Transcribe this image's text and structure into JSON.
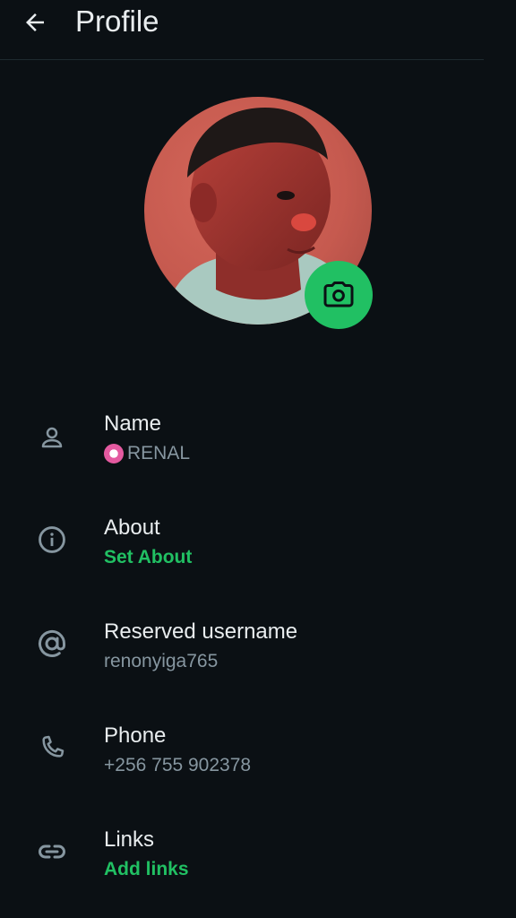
{
  "header": {
    "title": "Profile"
  },
  "rows": [
    {
      "label": "Name",
      "value": "RENAL",
      "icon": "person-icon"
    },
    {
      "label": "About",
      "value": "Set About",
      "icon": "info-icon"
    },
    {
      "label": "Reserved username",
      "value": "renonyiga765",
      "icon": "at-icon"
    },
    {
      "label": "Phone",
      "value": "+256 755 902378",
      "icon": "phone-icon"
    },
    {
      "label": "Links",
      "value": "Add links",
      "icon": "link-icon"
    }
  ],
  "colors": {
    "background": "#0b1014",
    "accent": "#21c063",
    "primary_text": "#e9edef",
    "secondary_text": "#8696a0"
  }
}
